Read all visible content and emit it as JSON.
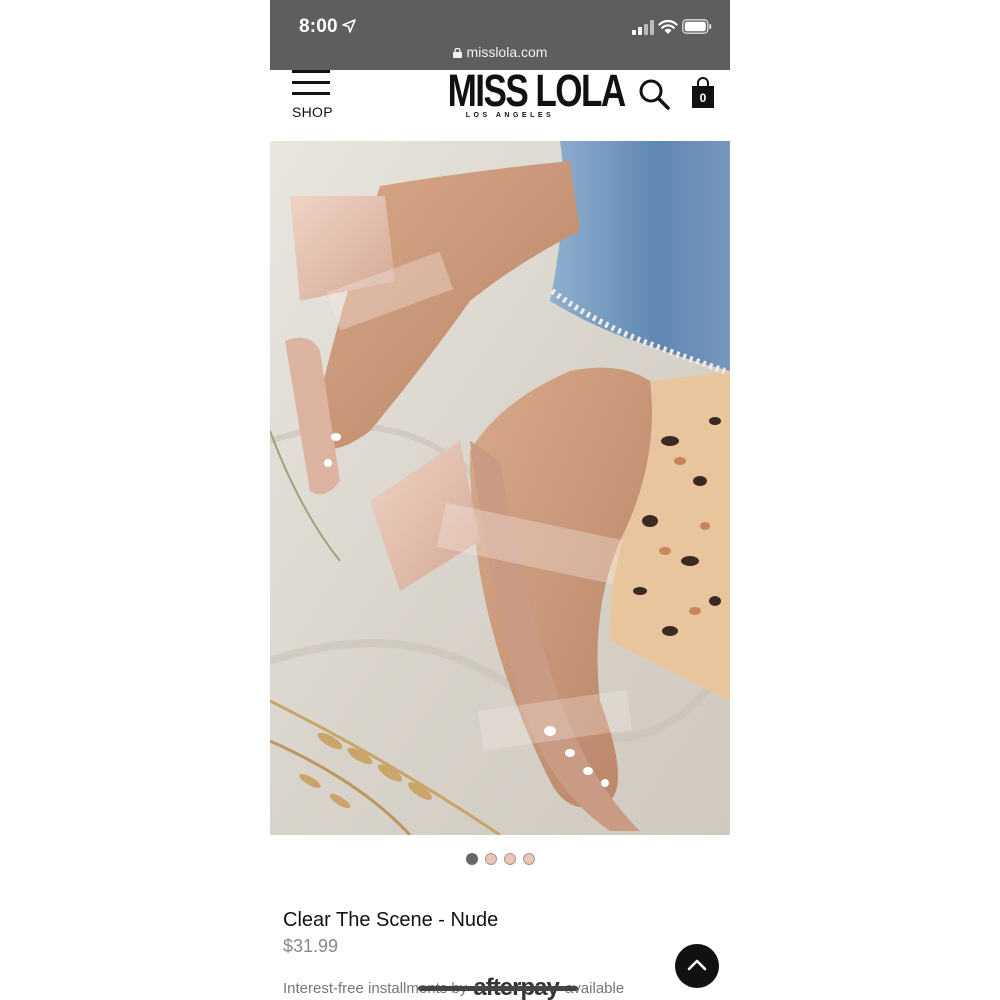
{
  "status_bar": {
    "time": "8:00",
    "url": "misslola.com",
    "icons": [
      "location-arrow-icon",
      "cellular-signal-icon",
      "wifi-icon",
      "battery-icon",
      "lock-icon"
    ]
  },
  "header": {
    "menu_label": "SHOP",
    "brand": "MISS LOLA",
    "brand_subtitle": "LOS ANGELES",
    "cart_count": "0",
    "icons": [
      "hamburger-menu-icon",
      "search-icon",
      "shopping-bag-icon"
    ]
  },
  "product": {
    "name": "Clear The Scene - Nude",
    "price": "$31.99",
    "image_subject": "product photo",
    "carousel_count": 4,
    "carousel_active_index": 0
  },
  "installments": {
    "prefix": "Interest-free installments by",
    "provider": "afterpay",
    "suffix": "available"
  },
  "colors": {
    "status_bar_bg": "#5e5e5e",
    "dot_active": "#666666",
    "dot_inactive": "#f0c4b2",
    "text_primary": "#111111",
    "price": "#888888"
  },
  "scroll_top_icon": "chevron-up-icon"
}
